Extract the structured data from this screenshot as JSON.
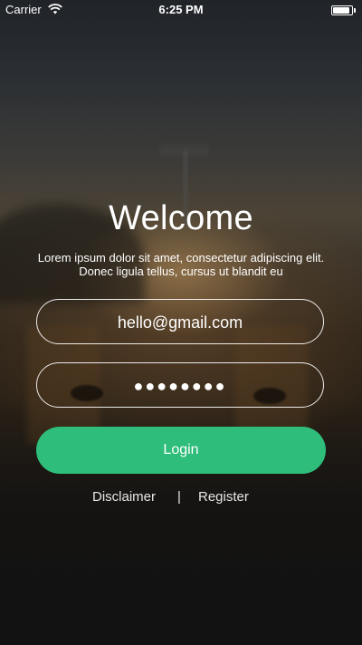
{
  "status_bar": {
    "carrier": "Carrier",
    "time": "6:25 PM",
    "battery_level": 0.9
  },
  "welcome": {
    "title": "Welcome",
    "subtitle": "Lorem ipsum dolor sit amet, consectetur adipiscing elit. Donec ligula tellus, cursus ut blandit eu"
  },
  "form": {
    "email_value": "hello@gmail.com",
    "password_value": "●●●●●●●●",
    "login_label": "Login"
  },
  "links": {
    "disclaimer": "Disclaimer",
    "divider": "|",
    "register": "Register"
  },
  "colors": {
    "accent": "#2ebd7a"
  }
}
